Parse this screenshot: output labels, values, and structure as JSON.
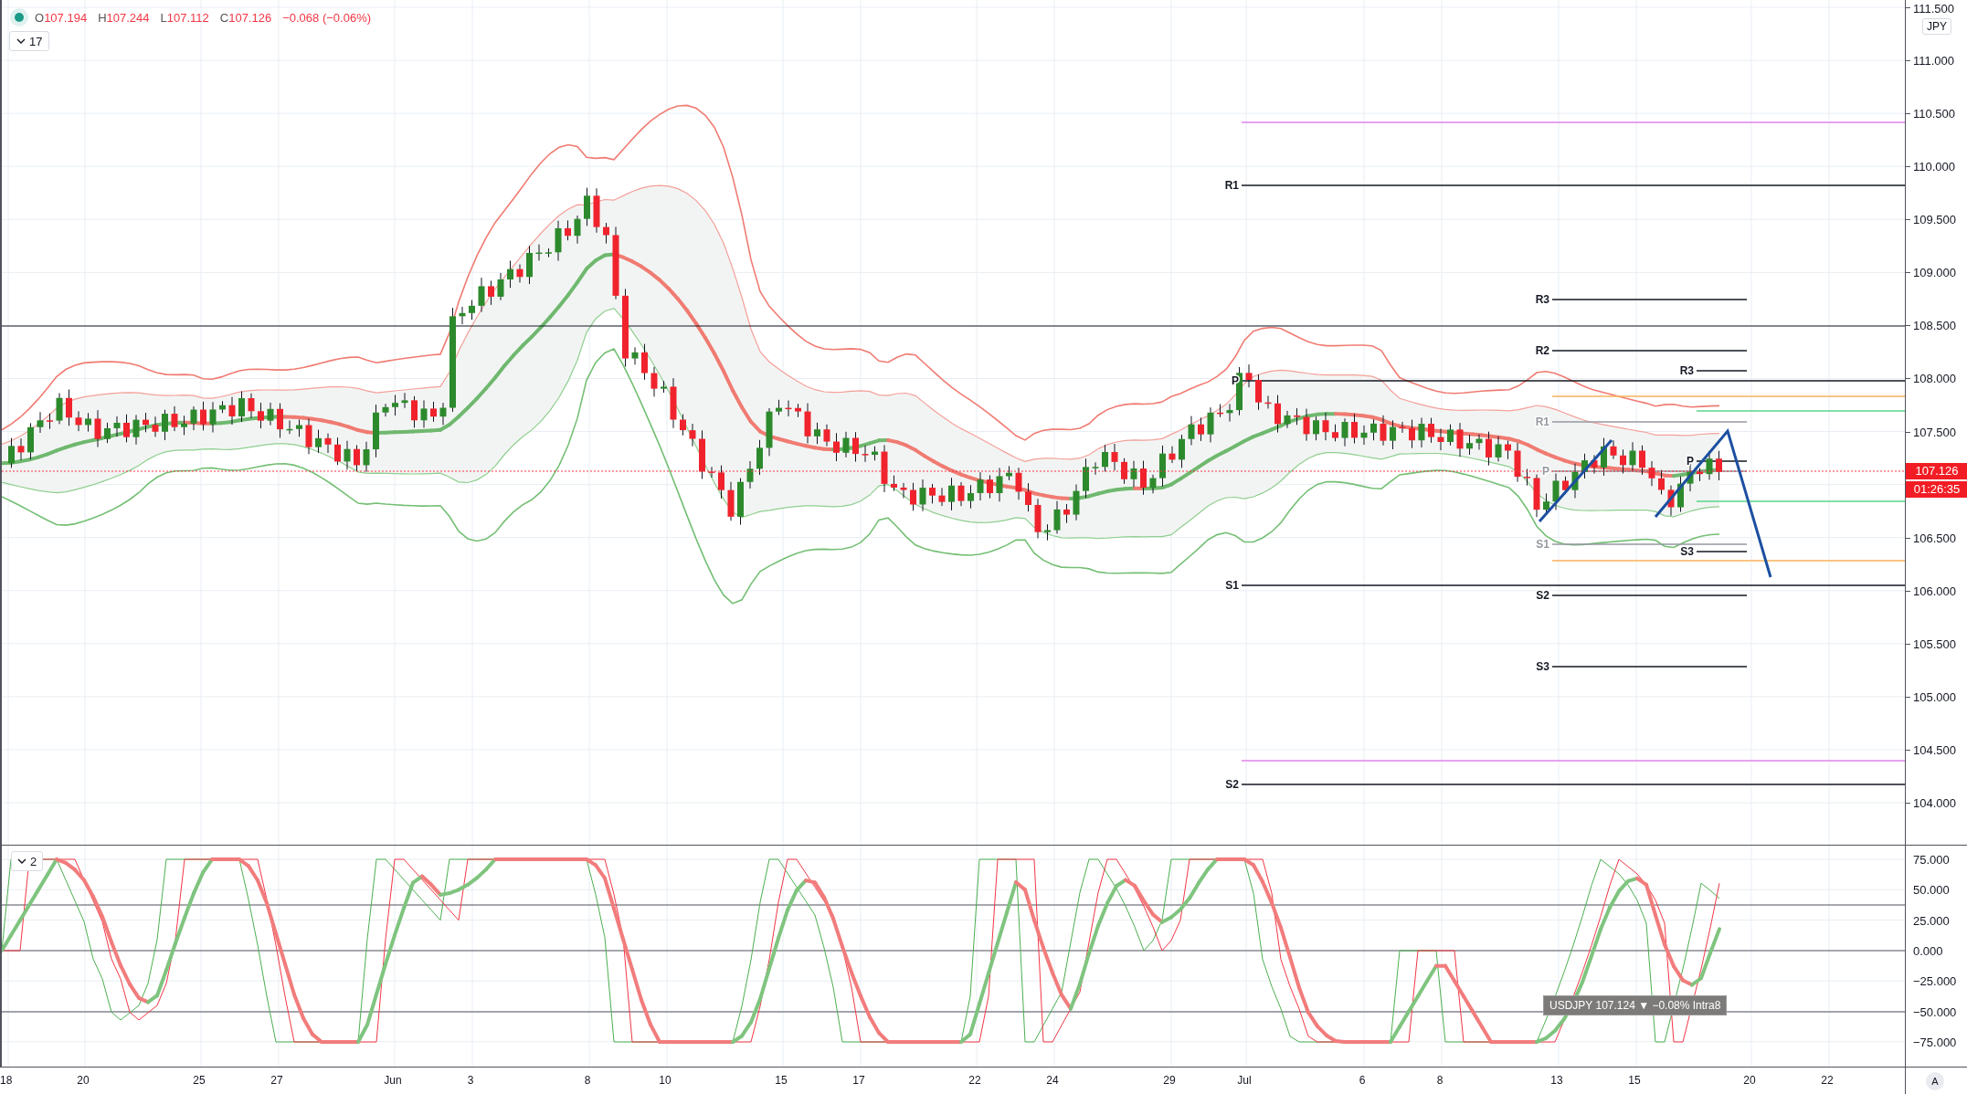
{
  "legend": {
    "ohlc": [
      {
        "label": "O",
        "value": "107.194"
      },
      {
        "label": "H",
        "value": "107.244"
      },
      {
        "label": "L",
        "value": "107.112"
      },
      {
        "label": "C",
        "value": "107.126"
      }
    ],
    "change": "−0.068 (−0.06%)",
    "interval_button": "17"
  },
  "pivots": [
    {
      "label": "R1",
      "muted": false
    },
    {
      "label": "P",
      "muted": false
    },
    {
      "label": "S1",
      "muted": false
    },
    {
      "label": "S2",
      "muted": false
    },
    {
      "label": "R3",
      "muted": false
    },
    {
      "label": "R2",
      "muted": false
    },
    {
      "label": "R1",
      "muted": true
    },
    {
      "label": "P",
      "muted": true
    },
    {
      "label": "S1",
      "muted": true
    },
    {
      "label": "S2",
      "muted": false
    },
    {
      "label": "S3",
      "muted": false
    },
    {
      "label": "R3",
      "muted": false
    },
    {
      "label": "P",
      "muted": false
    },
    {
      "label": "S3",
      "muted": false
    }
  ],
  "price_axis": {
    "currency_button": "JPY",
    "labels": [
      "111.500",
      "111.000",
      "110.500",
      "110.000",
      "109.500",
      "109.000",
      "108.500",
      "108.000",
      "107.500",
      "106.500",
      "106.000",
      "105.500",
      "105.000",
      "104.500",
      "104.000"
    ],
    "last_price": "107.126",
    "countdown": "01:26:35"
  },
  "oscillator": {
    "collapse_button": "2",
    "tooltip": "USDJPY 107.124 ▼ −0.08% Intra8",
    "labels": [
      "75.000",
      "50.000",
      "25.000",
      "0.000",
      "−25.000",
      "−50.000",
      "−75.000"
    ]
  },
  "time_axis": {
    "labels": [
      "18",
      "20",
      "25",
      "27",
      "Jun",
      "3",
      "8",
      "10",
      "15",
      "17",
      "22",
      "24",
      "29",
      "Jul",
      "6",
      "8",
      "13",
      "15",
      "20",
      "22"
    ],
    "auto_button": "A"
  }
}
